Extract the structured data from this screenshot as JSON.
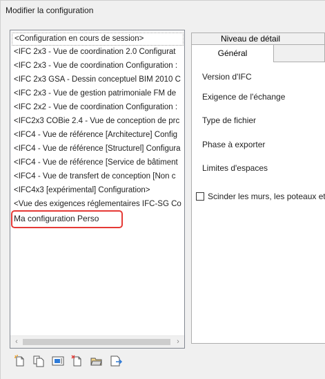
{
  "window": {
    "title": "Modifier la configuration"
  },
  "configs": [
    "<Configuration en cours de session>",
    "<IFC 2x3 - Vue de coordination 2.0 Configurat",
    "<IFC 2x3 - Vue de coordination Configuration :",
    "<IFC 2x3 GSA - Dessin conceptuel BIM 2010 C",
    "<IFC 2x3 - Vue de gestion patrimoniale FM de",
    "<IFC 2x2 - Vue de coordination Configuration :",
    "<IFC2x3 COBie 2.4 - Vue de conception de prc",
    "<IFC4 - Vue de référence [Architecture] Config",
    "<IFC4 - Vue de référence [Structurel] Configura",
    "<IFC4 - Vue de référence [Service de bâtiment",
    "<IFC4 - Vue de transfert de conception [Non c",
    "<IFC4x3 [expérimental] Configuration>",
    "<Vue des exigences réglementaires IFC-SG Co",
    "Ma configuration Perso"
  ],
  "tabs": {
    "detail": "Niveau de détail",
    "general": "Général"
  },
  "fields": {
    "ifc_version": "Version d'IFC",
    "exchange_req": "Exigence de l'échange",
    "file_type": "Type de fichier",
    "phase": "Phase à exporter",
    "space_bounds": "Limites d'espaces",
    "split_walls": "Scinder les murs, les poteaux et"
  },
  "toolbar": [
    "new-config-icon",
    "duplicate-config-icon",
    "rename-config-icon",
    "delete-config-icon",
    "load-config-icon",
    "save-config-icon"
  ],
  "accent": {
    "highlight": "#e53935",
    "icon_blue": "#2f7bd8",
    "icon_orange": "#f0a020"
  }
}
